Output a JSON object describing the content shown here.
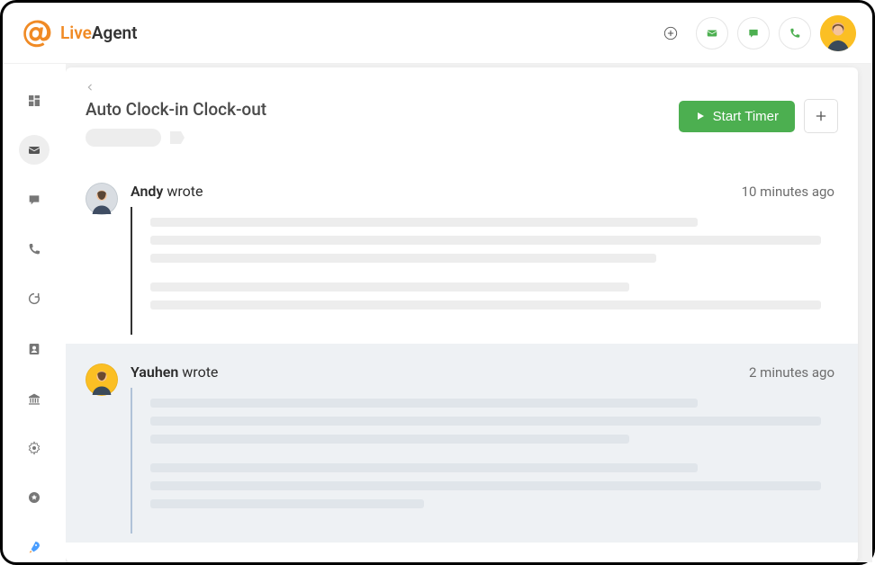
{
  "brand": {
    "part1": "Live",
    "part2": "Agent"
  },
  "header": {
    "title": "Auto Clock-in Clock-out",
    "start_timer_label": "Start Timer"
  },
  "topbar_icons": [
    "plus-icon",
    "mail-icon",
    "chat-icon",
    "phone-icon"
  ],
  "sidebar_icons": [
    "dashboard-icon",
    "mail-icon",
    "chat-icon",
    "phone-icon",
    "refresh-icon",
    "contact-icon",
    "bank-icon",
    "gear-icon",
    "star-icon",
    "rocket-icon"
  ],
  "thread": [
    {
      "author": "Andy",
      "verb": "wrote",
      "time": "10 minutes ago",
      "avatar_color": "gray",
      "timeline": "dark"
    },
    {
      "author": "Yauhen",
      "verb": "wrote",
      "time": "2 minutes ago",
      "avatar_color": "yellow",
      "timeline": "light"
    }
  ],
  "colors": {
    "accent_orange": "#f08a24",
    "accent_green": "#4caf50",
    "avatar_yellow": "#fbbf24"
  }
}
